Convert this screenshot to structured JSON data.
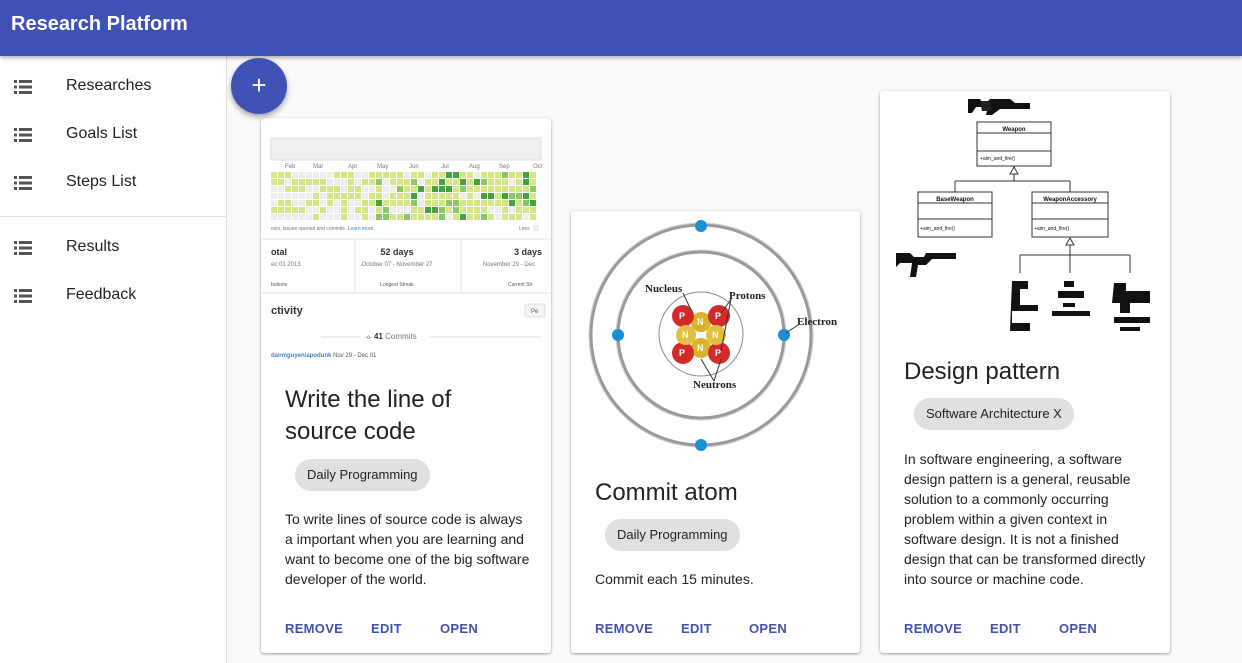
{
  "app": {
    "title": "Research Platform"
  },
  "sidebar": {
    "items": [
      {
        "label": "Researches",
        "icon": "list-icon"
      },
      {
        "label": "Goals List",
        "icon": "list-icon"
      },
      {
        "label": "Steps List",
        "icon": "list-icon"
      },
      {
        "label": "Results",
        "icon": "list-icon"
      },
      {
        "label": "Feedback",
        "icon": "list-icon"
      }
    ]
  },
  "fab": {
    "label": "+"
  },
  "colors": {
    "primary": "#3f51b5",
    "chip_bg": "#e0e0e0",
    "graph_green_light": "#d6e685",
    "graph_green_mid": "#8cc665",
    "graph_green_dark": "#44a340"
  },
  "cards": [
    {
      "title": "Write the line of source code",
      "chip": "Daily Programming",
      "description": "To write lines of source code is always a important when you are learning and want to become one of the big software developer of the world.",
      "actions": {
        "remove": "REMOVE",
        "edit": "EDIT",
        "open": "OPEN"
      },
      "media": {
        "months": [
          "Feb",
          "Mar",
          "Apr",
          "May",
          "Jun",
          "Jul",
          "Aug",
          "Sep",
          "Oct"
        ],
        "note": "ests, issues opened and commits.",
        "note_link": "Learn more.",
        "less": "Less",
        "stats": [
          {
            "value": "otal",
            "sub": "ec 01 2013",
            "caption": "butions"
          },
          {
            "value": "52 days",
            "sub": "October 07 - November 27",
            "caption": "Longest Streak"
          },
          {
            "value": "3 days",
            "sub": "November 29 - Dec",
            "caption": "Current Str"
          }
        ],
        "activity_title": "ctivity",
        "activity_button": "Pe",
        "commits_count": "41",
        "commits_label": "Commits",
        "repo": "danmguyen/apodunk",
        "repo_dates": "Nov 29 - Dec 01"
      }
    },
    {
      "title": "Commit atom",
      "chip": "Daily Programming",
      "description": "Commit each 15 minutes.",
      "actions": {
        "remove": "REMOVE",
        "edit": "EDIT",
        "open": "OPEN"
      },
      "media": {
        "labels": {
          "nucleus": "Nucleus",
          "protons": "Protons",
          "electron": "Electron",
          "neutrons": "Neutrons"
        },
        "proton_letter": "P",
        "neutron_letter": "N"
      }
    },
    {
      "title": "Design pattern",
      "chip": "Software Architecture X",
      "description": "In software engineering, a software design pattern is a general, reusable solution to a commonly occurring problem within a given context in software design. It is not a finished design that can be transformed directly into source or machine code.",
      "actions": {
        "remove": "REMOVE",
        "edit": "EDIT",
        "open": "OPEN"
      },
      "media": {
        "classes": [
          {
            "name": "Weapon",
            "method": "+aim_and_fire()"
          },
          {
            "name": "BaseWeapon",
            "method": "+aim_and_fire()"
          },
          {
            "name": "WeaponAccessory",
            "method": "+aim_and_fire()"
          }
        ]
      }
    }
  ]
}
